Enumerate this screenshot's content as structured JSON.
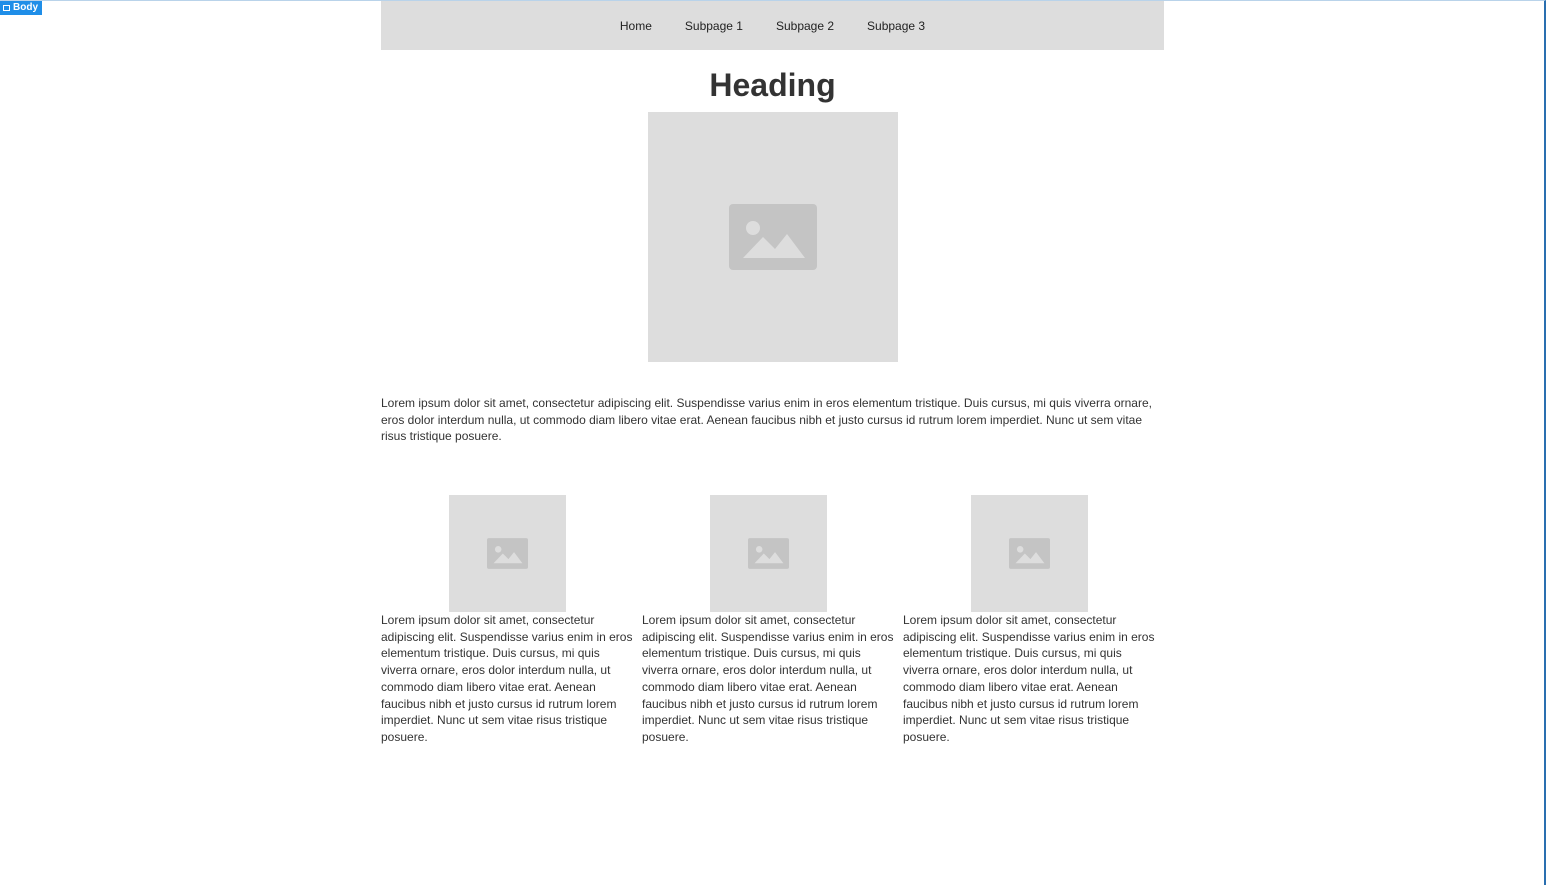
{
  "badge": {
    "label": "Body"
  },
  "nav": {
    "items": [
      {
        "label": "Home"
      },
      {
        "label": "Subpage 1"
      },
      {
        "label": "Subpage 2"
      },
      {
        "label": "Subpage 3"
      }
    ]
  },
  "main": {
    "heading": "Heading",
    "intro": "Lorem ipsum dolor sit amet, consectetur adipiscing elit. Suspendisse varius enim in eros elementum tristique. Duis cursus, mi quis viverra ornare, eros dolor interdum nulla, ut commodo diam libero vitae erat. Aenean faucibus nibh et justo cursus id rutrum lorem imperdiet. Nunc ut sem vitae risus tristique posuere.",
    "columns": [
      {
        "text": "Lorem ipsum dolor sit amet, consectetur adipiscing elit. Suspendisse varius enim in eros elementum tristique. Duis cursus, mi quis viverra ornare, eros dolor interdum nulla, ut commodo diam libero vitae erat. Aenean faucibus nibh et justo cursus id rutrum lorem imperdiet. Nunc ut sem vitae risus tristique posuere."
      },
      {
        "text": "Lorem ipsum dolor sit amet, consectetur adipiscing elit. Suspendisse varius enim in eros elementum tristique. Duis cursus, mi quis viverra ornare, eros dolor interdum nulla, ut commodo diam libero vitae erat. Aenean faucibus nibh et justo cursus id rutrum lorem imperdiet. Nunc ut sem vitae risus tristique posuere."
      },
      {
        "text": "Lorem ipsum dolor sit amet, consectetur adipiscing elit. Suspendisse varius enim in eros elementum tristique. Duis cursus, mi quis viverra ornare, eros dolor interdum nulla, ut commodo diam libero vitae erat. Aenean faucibus nibh et justo cursus id rutrum lorem imperdiet. Nunc ut sem vitae risus tristique posuere."
      }
    ]
  },
  "icons": {
    "placeholder": "image-placeholder-icon",
    "badge": "window-icon"
  },
  "colors": {
    "nav_bg": "#dddddd",
    "placeholder_bg": "#dddddd",
    "placeholder_icon": "#c4c4c4",
    "badge_bg": "#1f8ee8",
    "text": "#333333"
  }
}
